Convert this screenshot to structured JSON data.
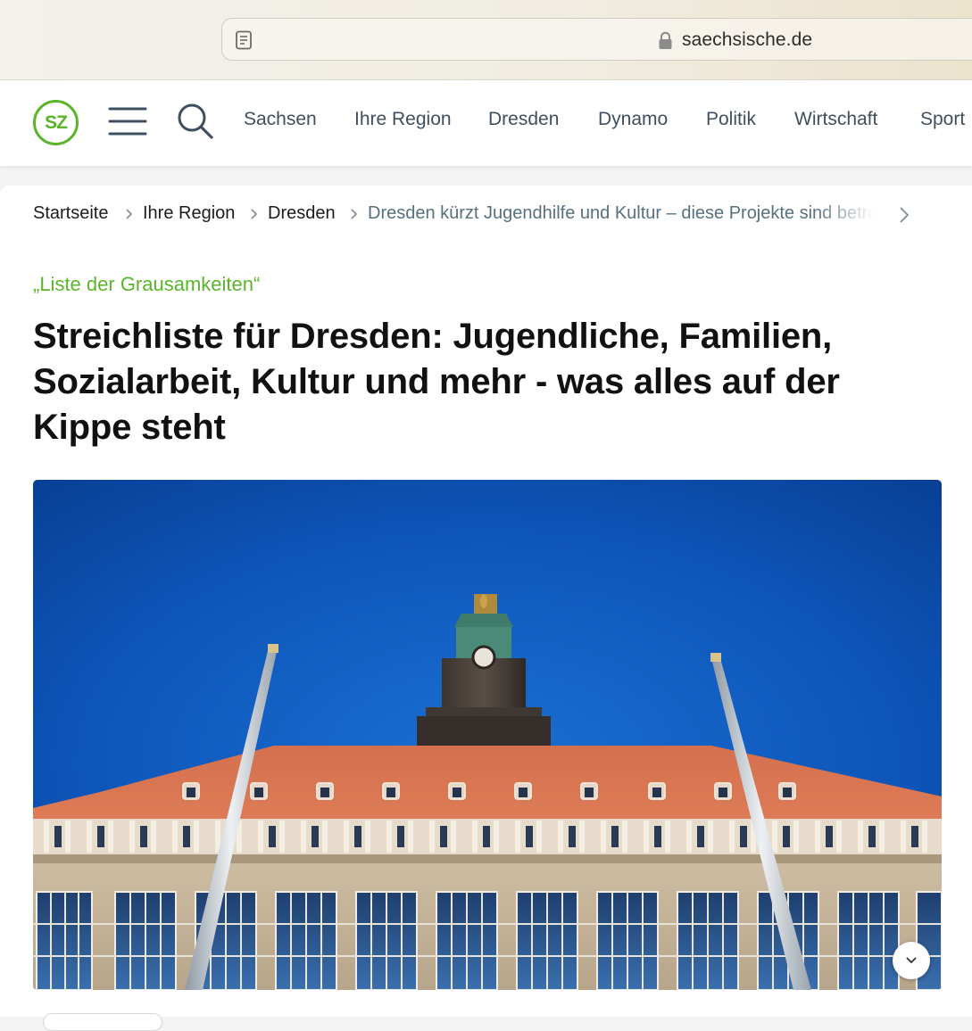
{
  "browser": {
    "url": "saechsische.de",
    "reader_icon": "reader-mode-icon",
    "lock_icon": "lock-icon"
  },
  "header": {
    "logo": "SZ",
    "menu_icon": "hamburger-menu-icon",
    "search_icon": "search-icon",
    "nav": [
      "Sachsen",
      "Ihre Region",
      "Dresden",
      "Dynamo",
      "Politik",
      "Wirtschaft",
      "Sport"
    ]
  },
  "breadcrumb": {
    "items": [
      "Startseite",
      "Ihre Region",
      "Dresden"
    ],
    "current": "Dresden kürzt Jugendhilfe und Kultur – diese Projekte sind betroffen"
  },
  "article": {
    "kicker": "„Liste der Grausamkeiten“",
    "headline": "Streichliste für Dresden: Jugendliche, Familien, Sozialarbeit, Kultur und mehr - was alles auf der Kippe steht"
  },
  "colors": {
    "brand_green": "#5ab52a",
    "nav_text": "#3f4f5f",
    "crumb_current": "#56707e"
  }
}
